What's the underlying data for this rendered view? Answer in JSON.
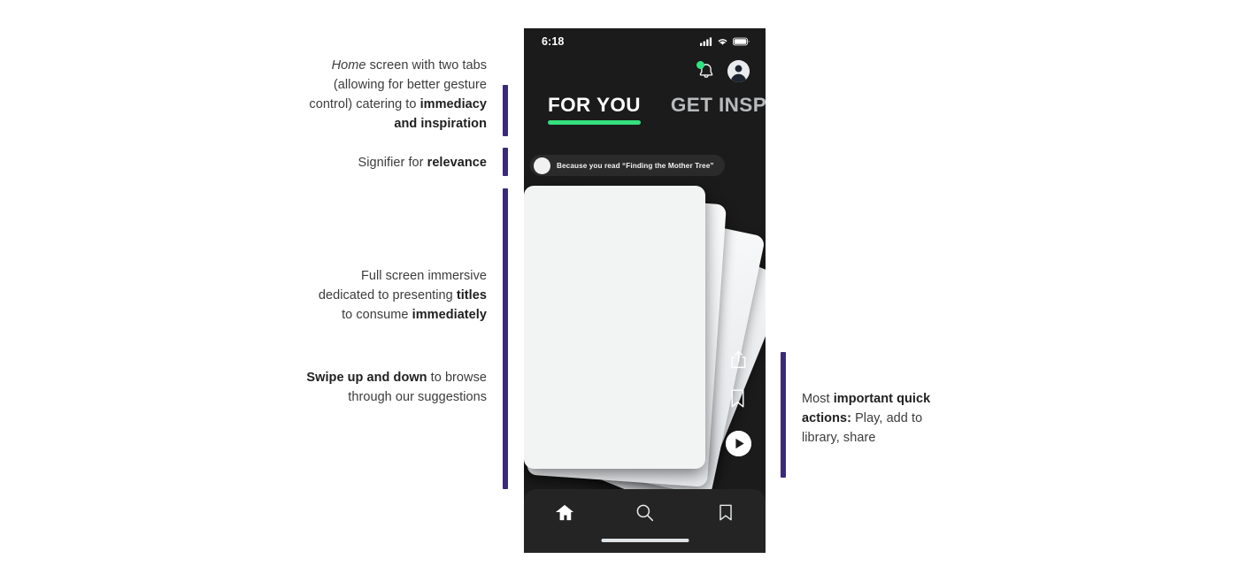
{
  "annotations": {
    "accent_color": "#3b2a78",
    "left": [
      {
        "id": "home-tabs",
        "parts": [
          {
            "text": "Home",
            "style": "italic"
          },
          {
            "text": " screen with two tabs (allowing for better gesture control) catering to ",
            "style": "normal"
          },
          {
            "text": "immediacy and inspiration",
            "style": "bold"
          }
        ]
      },
      {
        "id": "relevance",
        "parts": [
          {
            "text": "Signifier for ",
            "style": "normal"
          },
          {
            "text": "relevance",
            "style": "bold"
          }
        ]
      },
      {
        "id": "fullscreen-immersive",
        "parts": [
          {
            "text": "Full screen immersive dedicated to presenting ",
            "style": "normal"
          },
          {
            "text": "titles",
            "style": "bold"
          },
          {
            "text": " to consume ",
            "style": "normal"
          },
          {
            "text": "immediately",
            "style": "bold"
          }
        ]
      },
      {
        "id": "swipe",
        "parts": [
          {
            "text": "Swipe up and down",
            "style": "bold"
          },
          {
            "text": " to browse through our suggestions",
            "style": "normal"
          }
        ]
      }
    ],
    "right": [
      {
        "id": "quick-actions",
        "parts": [
          {
            "text": "Most ",
            "style": "normal"
          },
          {
            "text": "important quick actions:",
            "style": "bold"
          },
          {
            "text": " Play, add to library, share",
            "style": "normal"
          }
        ]
      }
    ]
  },
  "phone": {
    "background": "#1b1b1b",
    "status_bar": {
      "time": "6:18",
      "icons": [
        "cellular-signal-icon",
        "wifi-icon",
        "battery-icon"
      ]
    },
    "header": {
      "notification_icon": "bell-icon",
      "notification_badge": true,
      "notification_badge_color": "#2ee67f",
      "account_icon": "account-avatar-icon"
    },
    "tabs": {
      "active_index": 0,
      "accent_color": "#33e07d",
      "items": [
        {
          "label": "FOR YOU",
          "active": true
        },
        {
          "label": "GET INSPIRED",
          "active": false
        }
      ]
    },
    "relevance_chip": {
      "avatar": "book-cover-thumbnail",
      "text": "Because you read “Finding the Mother Tree”"
    },
    "card_stack": {
      "count": 4,
      "front_card_color": "#f1f4f3"
    },
    "quick_actions": [
      {
        "name": "share-icon",
        "label": "Share"
      },
      {
        "name": "bookmark-icon",
        "label": "Add to library"
      },
      {
        "name": "play-icon",
        "label": "Play"
      }
    ],
    "bottom_nav": {
      "items": [
        {
          "name": "home-icon",
          "label": "Home",
          "active": true
        },
        {
          "name": "search-icon",
          "label": "Search",
          "active": false
        },
        {
          "name": "bookmark-icon",
          "label": "Library",
          "active": false
        }
      ]
    }
  }
}
